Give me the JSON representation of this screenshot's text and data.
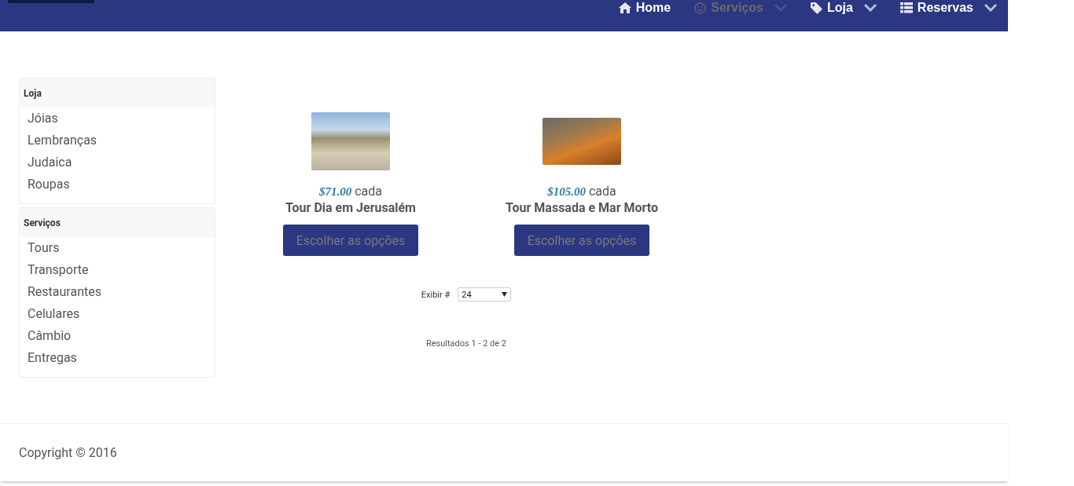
{
  "nav": {
    "items": [
      {
        "label": "Home",
        "muted": false,
        "dropdown": false
      },
      {
        "label": "Serviços",
        "muted": true,
        "dropdown": true
      },
      {
        "label": "Loja",
        "muted": false,
        "dropdown": true
      },
      {
        "label": "Reservas",
        "muted": false,
        "dropdown": true
      }
    ]
  },
  "sidebar": {
    "panels": [
      {
        "title": "Loja",
        "items": [
          "Jóias",
          "Lembranças",
          "Judaica",
          "Roupas"
        ]
      },
      {
        "title": "Serviços",
        "items": [
          "Tours",
          "Transporte",
          "Restaurantes",
          "Celulares",
          "Câmbio",
          "Entregas"
        ]
      }
    ]
  },
  "products": [
    {
      "price": "$71.00",
      "unit": "cada",
      "name": "Tour Dia em Jerusalém",
      "button": "Escolher as opções"
    },
    {
      "price": "$105.00",
      "unit": "cada",
      "name": "Tour Massada e Mar Morto",
      "button": "Escolher as opções"
    }
  ],
  "pager": {
    "label": "Exibir #",
    "value": "24",
    "results": "Resultados 1 - 2 de 2"
  },
  "footer": {
    "copyright": "Copyright © 2016"
  }
}
